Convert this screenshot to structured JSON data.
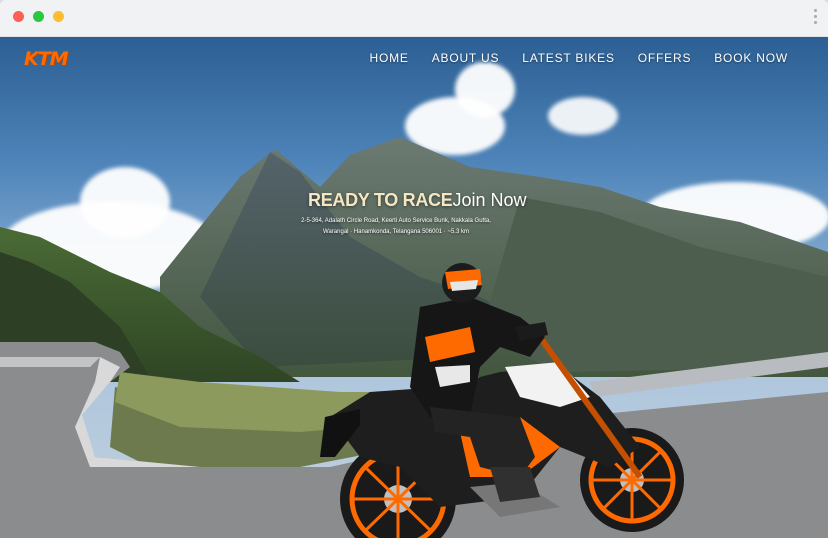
{
  "window": {
    "controls": [
      "close",
      "minimize",
      "maximize"
    ],
    "menu_icon": "kebab-menu-icon"
  },
  "site": {
    "logo_text": "KTM",
    "brand_color": "#ff6a00"
  },
  "nav": {
    "items": [
      {
        "label": "HOME"
      },
      {
        "label": "ABOUT US"
      },
      {
        "label": "LATEST BIKES"
      },
      {
        "label": "OFFERS"
      },
      {
        "label": "BOOK NOW"
      }
    ]
  },
  "hero": {
    "title_strong": "READY TO RACE",
    "title_light": "Join Now",
    "address_line1": "2-5-364, Adalath Circle Road, Keerti Auto Service Bunk, Nakkala Gutta,",
    "address_line2": "Warangal · Hanamkonda, Telangana 506001 · ~5.3 km"
  }
}
